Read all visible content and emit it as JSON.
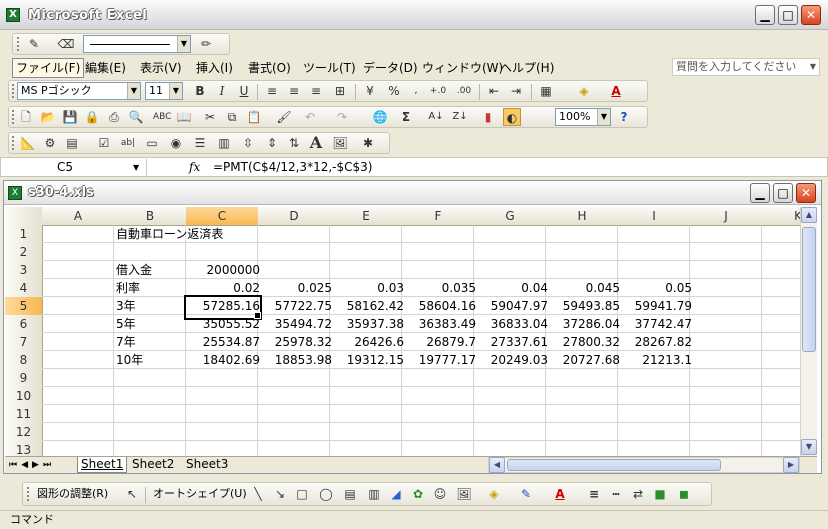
{
  "app": {
    "title": "Microsoft Excel",
    "icon_glyph": "X"
  },
  "menu": {
    "items": [
      "ファイル(F)",
      "編集(E)",
      "表示(V)",
      "挿入(I)",
      "書式(O)",
      "ツール(T)",
      "データ(D)",
      "ウィンドウ(W)",
      "ヘルプ(H)"
    ],
    "help_search_placeholder": "質問を入力してください"
  },
  "format_toolbar": {
    "font_name": "MS Pゴシック",
    "font_size": "11"
  },
  "standard_toolbar": {
    "zoom": "100%"
  },
  "formula_bar": {
    "name_box": "C5",
    "fx": "fx",
    "formula": "=PMT(C$4/12,3*12,-$C$3)"
  },
  "workbook": {
    "filename": "s30-4.xls"
  },
  "grid": {
    "columns": [
      "A",
      "B",
      "C",
      "D",
      "E",
      "F",
      "G",
      "H",
      "I",
      "J",
      "K"
    ],
    "rows": [
      "1",
      "2",
      "3",
      "4",
      "5",
      "6",
      "7",
      "8",
      "9",
      "10",
      "11",
      "12",
      "13"
    ],
    "active_cell": "C5",
    "title": "自動車ローン返済表",
    "loan_label": "借入金",
    "loan_amount": "2000000",
    "rate_label": "利率",
    "rates": [
      "0.02",
      "0.025",
      "0.03",
      "0.035",
      "0.04",
      "0.045",
      "0.05"
    ],
    "terms": [
      {
        "label": "3年",
        "values": [
          "57285.16",
          "57722.75",
          "58162.42",
          "58604.16",
          "59047.97",
          "59493.85",
          "59941.79"
        ]
      },
      {
        "label": "5年",
        "values": [
          "35055.52",
          "35494.72",
          "35937.38",
          "36383.49",
          "36833.04",
          "37286.04",
          "37742.47"
        ]
      },
      {
        "label": "7年",
        "values": [
          "25534.87",
          "25978.32",
          "26426.6",
          "26879.7",
          "27337.61",
          "27800.32",
          "28267.82"
        ]
      },
      {
        "label": "10年",
        "values": [
          "18402.69",
          "18853.98",
          "19312.15",
          "19777.17",
          "20249.03",
          "20727.68",
          "21213.1"
        ]
      }
    ]
  },
  "sheet_tabs": [
    "Sheet1",
    "Sheet2",
    "Sheet3"
  ],
  "active_sheet": "Sheet1",
  "drawing_toolbar": {
    "draw_label": "図形の調整(R)",
    "autoshape_label": "オートシェイプ(U)"
  },
  "status": {
    "text": "コマンド"
  }
}
